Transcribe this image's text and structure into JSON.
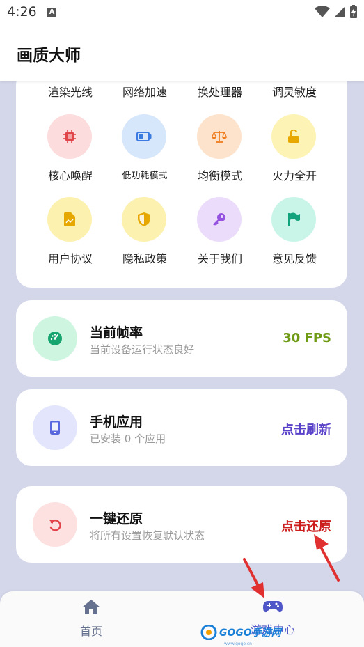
{
  "status_bar": {
    "time": "4:26",
    "a_icon_letter": "A"
  },
  "app_bar": {
    "title": "画质大师"
  },
  "grid": {
    "top_row": [
      "渲染光线",
      "网络加速",
      "换处理器",
      "调灵敏度"
    ],
    "items": [
      {
        "label": "核心唤醒",
        "icon": "chip-icon",
        "bg": "#fcdcdc",
        "fg": "#e0454a"
      },
      {
        "label": "低功耗模式",
        "icon": "battery-icon",
        "bg": "#d6e6fb",
        "fg": "#3b7ae0"
      },
      {
        "label": "均衡模式",
        "icon": "scale-icon",
        "bg": "#fde3cc",
        "fg": "#ef7b1d"
      },
      {
        "label": "火力全开",
        "icon": "unlock-icon",
        "bg": "#fdf3b5",
        "fg": "#e8a800"
      },
      {
        "label": "用户协议",
        "icon": "document-icon",
        "bg": "#fdf1b0",
        "fg": "#e6a800"
      },
      {
        "label": "隐私政策",
        "icon": "shield-icon",
        "bg": "#fdf1b0",
        "fg": "#e6a800"
      },
      {
        "label": "关于我们",
        "icon": "key-icon",
        "bg": "#ecdcfb",
        "fg": "#9552e0"
      },
      {
        "label": "意见反馈",
        "icon": "flag-icon",
        "bg": "#c9f5e8",
        "fg": "#13a37c"
      }
    ]
  },
  "cards": [
    {
      "title": "当前帧率",
      "subtitle": "当前设备运行状态良好",
      "action": "30 FPS",
      "action_color": "#6e9a14",
      "icon": "speedometer-icon",
      "icon_bg": "#cdf5e0",
      "icon_fg": "#16a56f"
    },
    {
      "title": "手机应用",
      "subtitle": "已安装 0 个应用",
      "action": "点击刷新",
      "action_color": "#5a42c8",
      "icon": "phone-icon",
      "icon_bg": "#e2e5fb",
      "icon_fg": "#5867dd"
    },
    {
      "title": "一键还原",
      "subtitle": "将所有设置恢复默认状态",
      "action": "点击还原",
      "action_color": "#cc1c1c",
      "icon": "undo-icon",
      "icon_bg": "#fde0e0",
      "icon_fg": "#e2454a"
    }
  ],
  "bottom_nav": {
    "items": [
      {
        "label": "首页",
        "icon": "home-icon",
        "color": "#66718f"
      },
      {
        "label": "游戏中心",
        "icon": "gamepad-icon",
        "color": "#4e56c8"
      }
    ]
  },
  "watermark": {
    "text": "GOGO手游网",
    "sub": "www.gogo.cn"
  },
  "annotation_color": "#e03030"
}
